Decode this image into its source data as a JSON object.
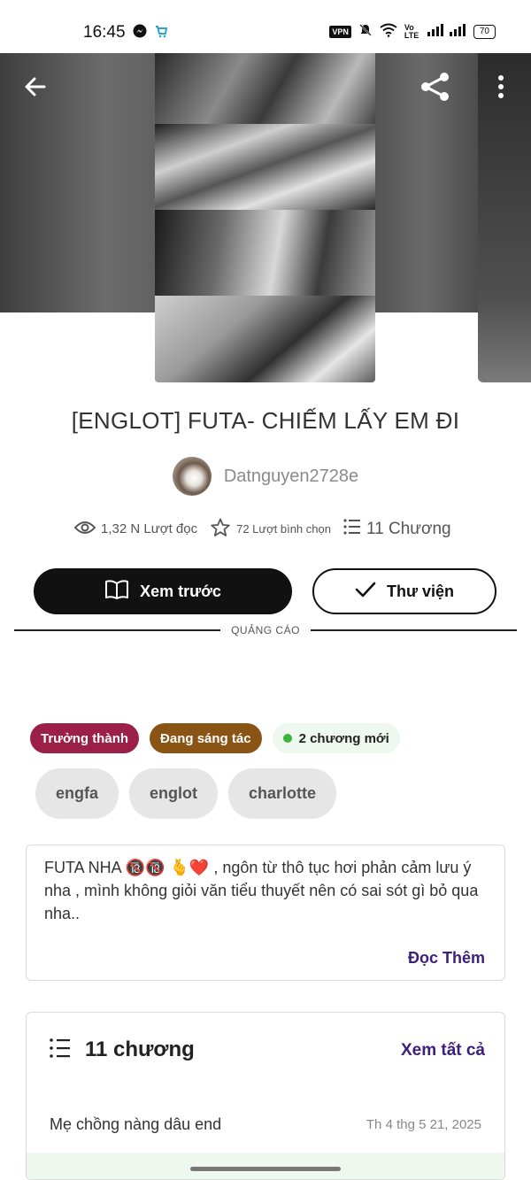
{
  "status_bar": {
    "time": "16:45",
    "vpn": "VPN",
    "network_label": "Vo LTE",
    "battery": "70",
    "icons": [
      "messenger-icon",
      "shop-icon",
      "mute-icon",
      "wifi-icon",
      "signal-icon"
    ]
  },
  "header": {
    "icons": [
      "back-arrow-icon",
      "share-icon",
      "more-vertical-icon"
    ]
  },
  "story": {
    "title": "[ENGLOT] FUTA- CHIẾM LẤY EM ĐI",
    "author": "Datnguyen2728e",
    "reads": "1,32 N Lượt đọc",
    "votes": "72 Lượt bình chọn",
    "chapters": "11 Chương"
  },
  "actions": {
    "preview_label": "Xem trước",
    "library_label": "Thư viện"
  },
  "ad": {
    "label": "QUẢNG CÁO"
  },
  "badges": {
    "mature": "Trưởng thành",
    "ongoing": "Đang sáng tác",
    "new_chapters": "2 chương mới"
  },
  "tags": [
    "engfa",
    "englot",
    "charlotte"
  ],
  "description": {
    "text": "FUTA NHA 🔞🔞 🫰❤️ , ngôn từ thô tục hơi phản cảm lưu ý nha , mình không giỏi văn tiểu thuyết nên có sai sót gì bỏ qua nha..",
    "read_more": "Đọc Thêm"
  },
  "chapters_section": {
    "title": "11 chương",
    "see_all": "Xem tất cả",
    "items": [
      {
        "name": "Mẹ chồng nàng dâu end",
        "date": "Th 4 thg 5 21, 2025"
      }
    ]
  },
  "colors": {
    "mature_badge": "#9c1f48",
    "ongoing_badge": "#8a5414",
    "new_badge_bg": "#eef8ee",
    "link": "#3b1f7a",
    "primary_button": "#111111"
  }
}
